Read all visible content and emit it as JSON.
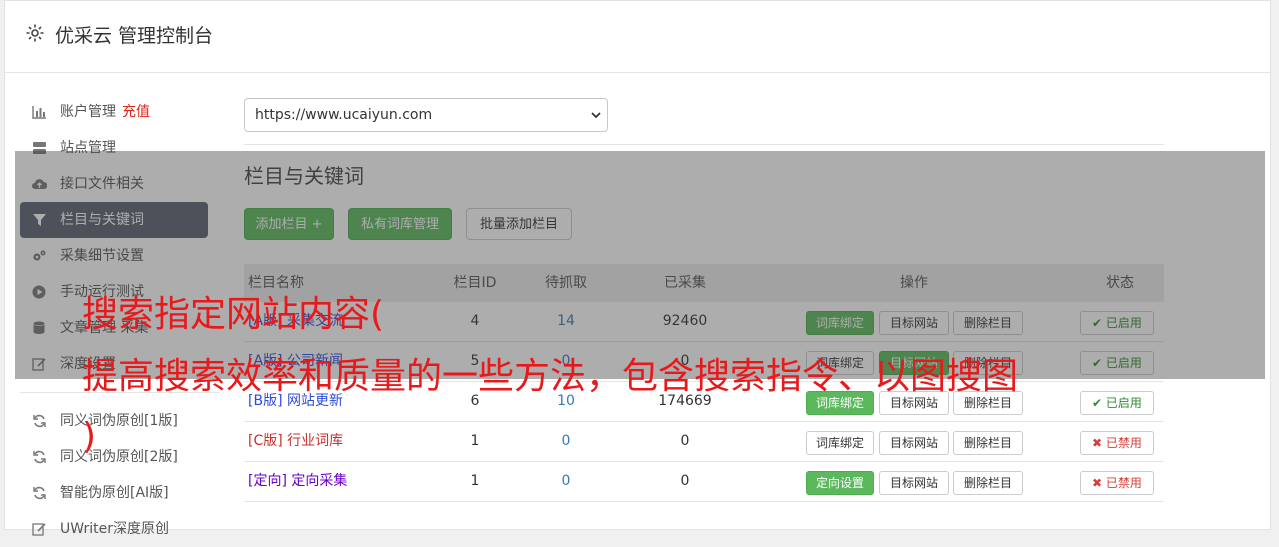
{
  "header": {
    "title": "优采云 管理控制台",
    "icon": "gear-icon"
  },
  "sidebar": {
    "items": [
      {
        "label": "账户管理",
        "extra": "充值",
        "icon": "bar-chart-icon"
      },
      {
        "label": "站点管理",
        "icon": "server-icon"
      },
      {
        "label": "接口文件相关",
        "icon": "cloud-upload-icon"
      },
      {
        "label": "栏目与关键词",
        "icon": "filter-icon",
        "active": true
      },
      {
        "label": "采集细节设置",
        "icon": "cogs-icon"
      },
      {
        "label": "手动运行测试",
        "icon": "play-circle-icon"
      },
      {
        "label": "文章管理 采集",
        "icon": "database-icon"
      },
      {
        "label": "深度设置",
        "icon": "edit-icon"
      }
    ],
    "items2": [
      {
        "label": "同义词伪原创[1版]",
        "icon": "refresh-icon"
      },
      {
        "label": "同义词伪原创[2版]",
        "icon": "refresh-icon"
      },
      {
        "label": "智能伪原创[AI版]",
        "icon": "refresh-icon"
      },
      {
        "label": "UWriter深度原创",
        "icon": "edit-icon"
      }
    ]
  },
  "site_select": {
    "value": "https://www.ucaiyun.com"
  },
  "section": {
    "title": "栏目与关键词"
  },
  "buttons": {
    "add_column": "添加栏目 +",
    "private_lib": "私有词库管理",
    "batch_add": "批量添加栏目"
  },
  "table": {
    "headers": {
      "name": "栏目名称",
      "id": "栏目ID",
      "todo": "待抓取",
      "done": "已采集",
      "ops": "操作",
      "status": "状态"
    },
    "rows": [
      {
        "tag": "[A版]",
        "name": "采集交流",
        "id": "4",
        "todo": "14",
        "done": "92460",
        "op1": "词库绑定",
        "op2": "目标网站",
        "op3": "删除栏目",
        "status": "已启用",
        "status_on": true
      },
      {
        "tag": "[A版]",
        "name": "公司新闻",
        "id": "5",
        "todo": "0",
        "done": "0",
        "op1": "词库绑定",
        "op2": "目标网站",
        "op3": "删除栏目",
        "status": "已启用",
        "status_on": true
      },
      {
        "tag": "[B版]",
        "name": "网站更新",
        "id": "6",
        "todo": "10",
        "done": "174669",
        "op1": "词库绑定",
        "op2": "目标网站",
        "op3": "删除栏目",
        "status": "已启用",
        "status_on": true
      },
      {
        "tag": "[C版]",
        "name": "行业词库",
        "id": "1",
        "todo": "0",
        "done": "0",
        "op1": "词库绑定",
        "op2": "目标网站",
        "op3": "删除栏目",
        "status": "已禁用",
        "status_on": false
      },
      {
        "tag": "[定向]",
        "name": "定向采集",
        "id": "1",
        "todo": "0",
        "done": "0",
        "op1": "定向设置",
        "op2": "目标网站",
        "op3": "删除栏目",
        "status": "已禁用",
        "status_on": false
      }
    ]
  },
  "overlay_text": {
    "line1": "搜索指定网站内容(",
    "line2": "提高搜索效率和质量的一些方法，包含搜索指令、以图搜图",
    "line3": ")"
  },
  "colors": {
    "accent_green": "#5cb85c",
    "active_bg": "#5a6370",
    "headline_red": "#e8191b"
  }
}
